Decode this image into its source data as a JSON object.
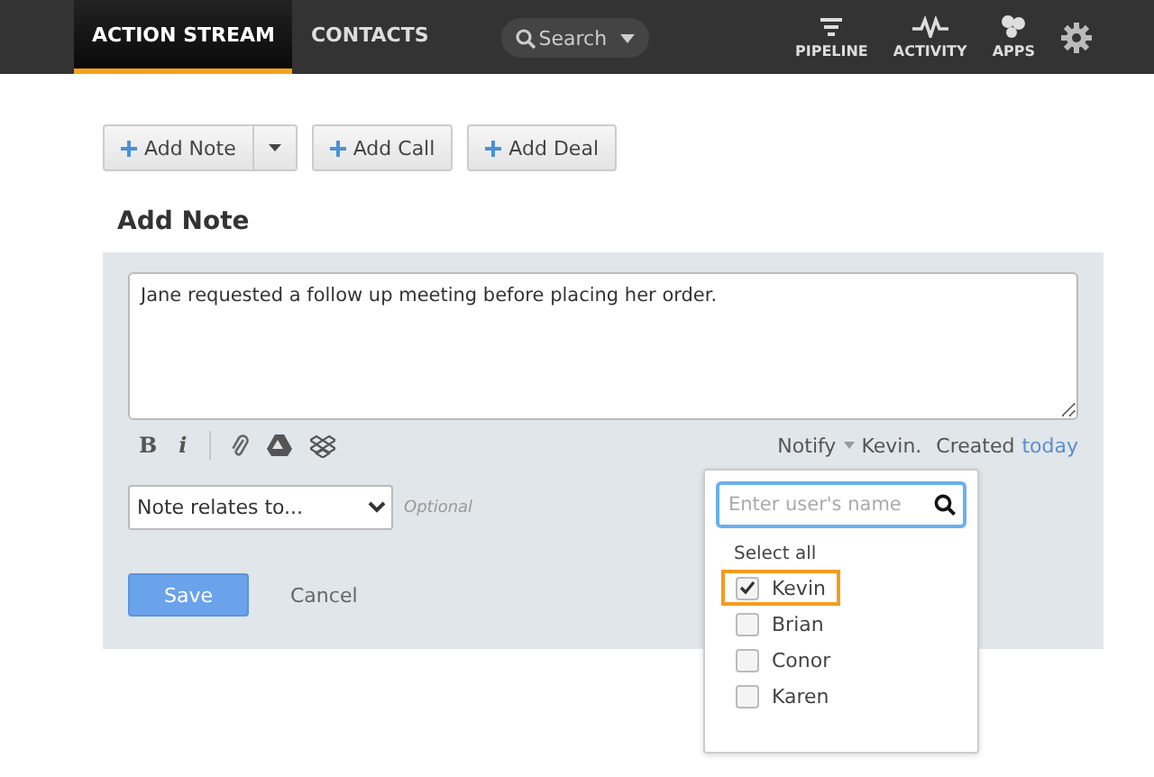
{
  "nav": {
    "tabs": [
      {
        "label": "ACTION STREAM",
        "selected": true
      },
      {
        "label": "CONTACTS",
        "selected": false
      }
    ],
    "search": {
      "placeholder": "Search"
    },
    "apps": [
      {
        "kind": "pipeline",
        "label": "PIPELINE"
      },
      {
        "kind": "activity",
        "label": "ACTIVITY"
      },
      {
        "kind": "apps",
        "label": "APPS"
      },
      {
        "kind": "settings"
      }
    ]
  },
  "actions": [
    "Add Note",
    "Add Call",
    "Add Deal"
  ],
  "heading": "Add Note",
  "format_buttons": [
    {
      "kind": "bold",
      "label": "B"
    },
    {
      "kind": "italic",
      "label": "i"
    }
  ],
  "note": {
    "value": "Jane requested a follow up meeting before placing her order.",
    "notify_label": "Notify",
    "notify_value": "Kevin.",
    "created_label": "Created",
    "created_link": "today",
    "relates": "Note relates to...",
    "optional": "Optional",
    "save": "Save",
    "cancel": "Cancel"
  },
  "popup": {
    "placeholder": "Enter user's name",
    "select_all": "Select all",
    "users": [
      {
        "name": "Kevin",
        "checked": true,
        "highlighted": true
      },
      {
        "name": "Brian",
        "checked": false,
        "highlighted": false
      },
      {
        "name": "Conor",
        "checked": false,
        "highlighted": false
      },
      {
        "name": "Karen",
        "checked": false,
        "highlighted": false
      }
    ]
  }
}
